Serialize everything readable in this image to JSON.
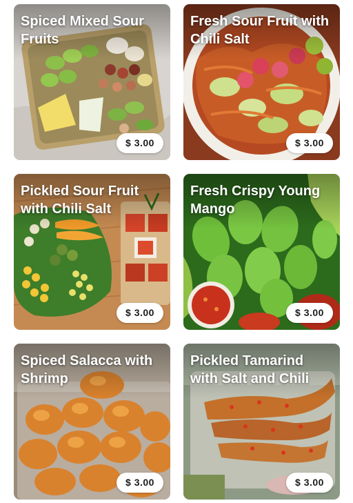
{
  "menu": {
    "items": [
      {
        "title": "Spiced Mixed Sour Fruits",
        "price": "$ 3.00"
      },
      {
        "title": "Fresh Sour Fruit with Chili Salt",
        "price": "$ 3.00"
      },
      {
        "title": "Pickled Sour Fruit with Chili Salt",
        "price": "$ 3.00"
      },
      {
        "title": "Fresh Crispy Young Mango",
        "price": "$ 3.00"
      },
      {
        "title": "Spiced Salacca with Shrimp",
        "price": "$ 3.00"
      },
      {
        "title": "Pickled Tamarind with Salt and Chili",
        "price": "$ 3.00"
      }
    ]
  }
}
